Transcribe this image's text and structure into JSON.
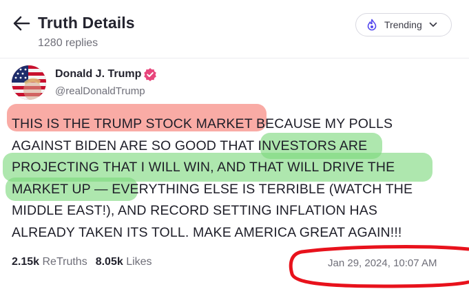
{
  "header": {
    "title": "Truth Details",
    "replies": "1280 replies",
    "trending_label": "Trending"
  },
  "post": {
    "author_name": "Donald J. Trump",
    "handle": "@realDonaldTrump",
    "lines": [
      "THIS IS THE TRUMP STOCK MARKET BECAUSE MY POLLS",
      "AGAINST BIDEN ARE SO GOOD THAT INVESTORS ARE",
      "PROJECTING THAT I WILL WIN, AND THAT WILL DRIVE THE",
      "MARKET UP — EVERYTHING ELSE IS TERRIBLE (WATCH THE",
      "MIDDLE EAST!), AND RECORD SETTING INFLATION HAS",
      "ALREADY TAKEN ITS TOLL. MAKE AMERICA GREAT AGAIN!!!"
    ],
    "retruths_count": "2.15k",
    "retruths_label": "ReTruths",
    "likes_count": "8.05k",
    "likes_label": "Likes",
    "timestamp": "Jan 29, 2024, 10:07 AM"
  },
  "colors": {
    "accent_purple": "#5448ee",
    "verified_pink": "#e8467c",
    "highlight_red": "#f6786e",
    "highlight_green": "#7cd87c",
    "annotation_red": "#e8121c"
  },
  "icons": [
    "back-arrow-icon",
    "trending-icon",
    "chevron-down-icon",
    "verified-icon"
  ]
}
